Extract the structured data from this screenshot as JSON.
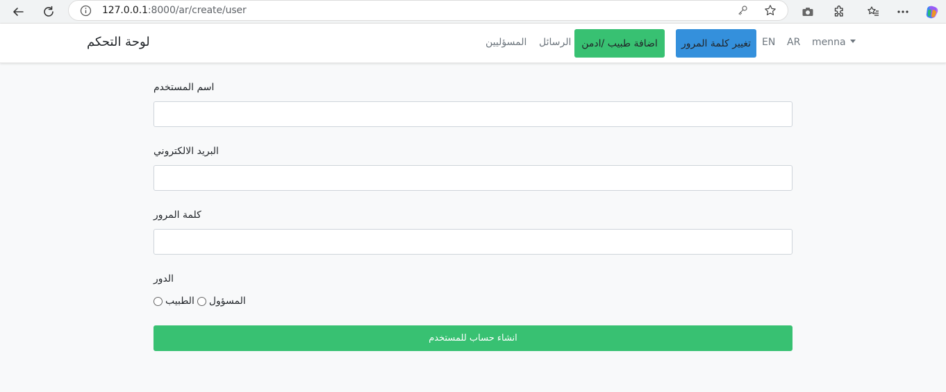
{
  "browser": {
    "url_host": "127.0.0.1",
    "url_path": ":8000/ar/create/user"
  },
  "navbar": {
    "brand": "لوحة التحكم",
    "links": {
      "admins": "المسؤليين",
      "messages": "الرسائل",
      "add_doctor": "اضافة طبيب /ادمن",
      "change_password": "تغيير كلمة المرور",
      "en": "EN",
      "ar": "AR",
      "user": "menna"
    },
    "colors": {
      "green": "#38c172",
      "blue": "#3490dc"
    }
  },
  "form": {
    "username_label": "اسم المستخدم",
    "email_label": "البريد الالكتروني",
    "password_label": "كلمة المرور",
    "role_label": "الدور",
    "role_options": {
      "doctor": "الطبيب",
      "admin": "المسؤول"
    },
    "submit_label": "انشاء حساب للمستخدم"
  }
}
